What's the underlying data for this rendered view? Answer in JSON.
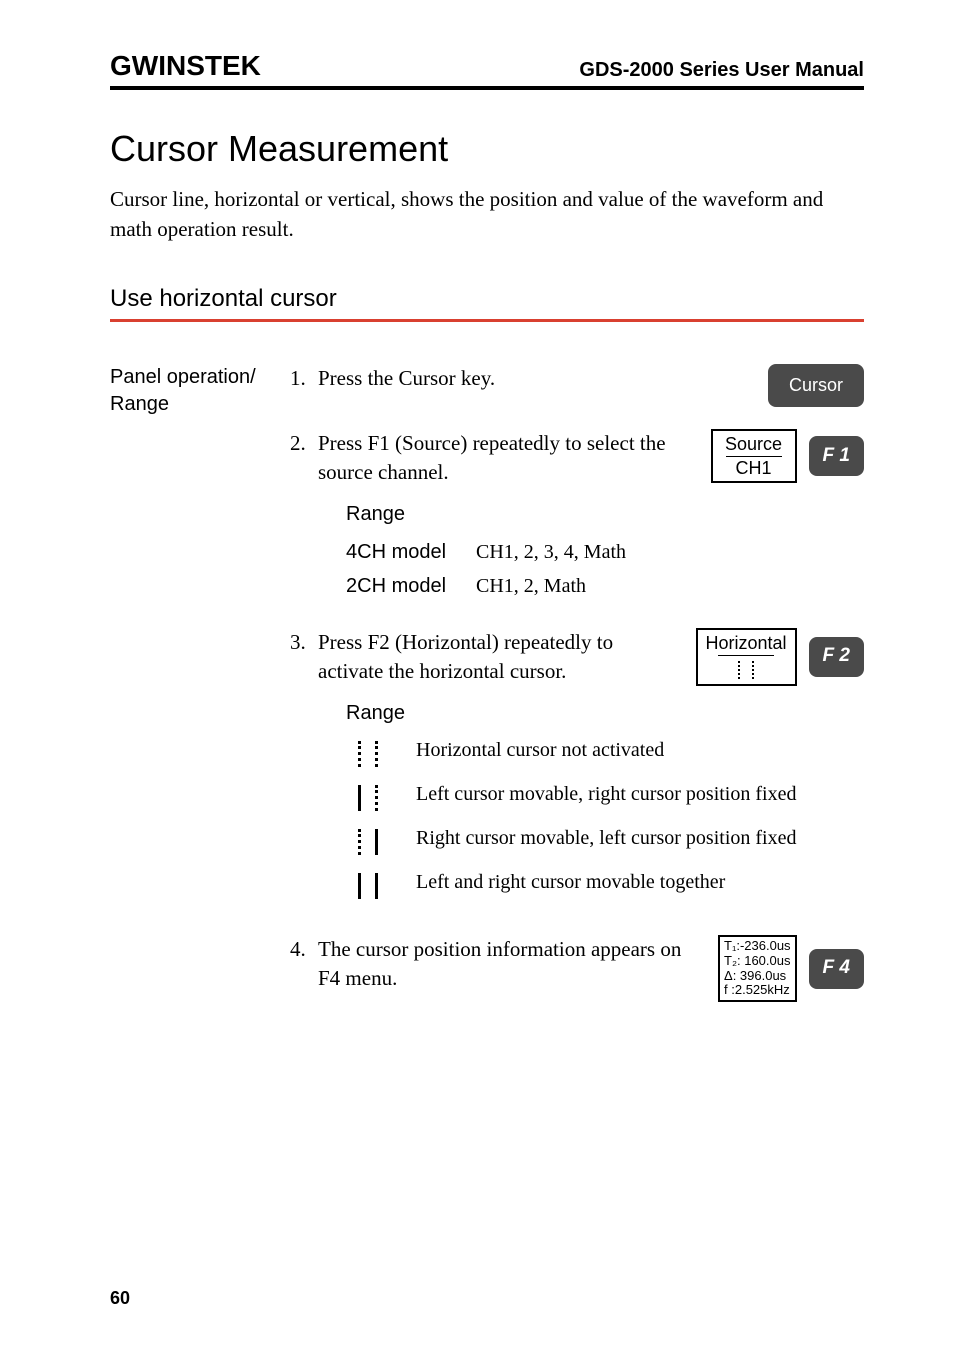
{
  "header": {
    "logo": "GWINSTEK",
    "title": "GDS-2000 Series User Manual"
  },
  "pageTitle": "Cursor Measurement",
  "intro": "Cursor line, horizontal or vertical, shows the position and value of the waveform and math operation result.",
  "sectionHeading": "Use horizontal cursor",
  "leftLabel1": "Panel operation/",
  "leftLabel2": "Range",
  "steps": {
    "s1": {
      "num": "1.",
      "text": "Press the Cursor key.",
      "btn": "Cursor"
    },
    "s2": {
      "num": "2.",
      "text": "Press F1 (Source) repeatedly to select the source channel.",
      "osd1": "Source",
      "osd2": "CH1",
      "f": "F  1",
      "rangeLabel": "Range",
      "spec": {
        "r1k": "4CH model",
        "r1v": "CH1, 2, 3, 4, Math",
        "r2k": "2CH model",
        "r2v": "CH1, 2, Math"
      }
    },
    "s3": {
      "num": "3.",
      "text": "Press F2 (Horizontal) repeatedly to activate the horizontal cursor.",
      "osd": "Horizontal",
      "f": "F  2",
      "rangeLabel": "Range",
      "rows": {
        "r1": "Horizontal cursor not activated",
        "r2": "Left cursor movable, right cursor position fixed",
        "r3": "Right cursor movable, left cursor position fixed",
        "r4": "Left and right cursor movable together"
      }
    },
    "s4": {
      "num": "4.",
      "text": "The cursor position information appears on F4 menu.",
      "info": {
        "l1": "T₁:-236.0us",
        "l2": "T₂: 160.0us",
        "l3": "Δ:  396.0us",
        "l4": "f :2.525kHz"
      },
      "f": "F  4"
    }
  },
  "pageNum": "60"
}
